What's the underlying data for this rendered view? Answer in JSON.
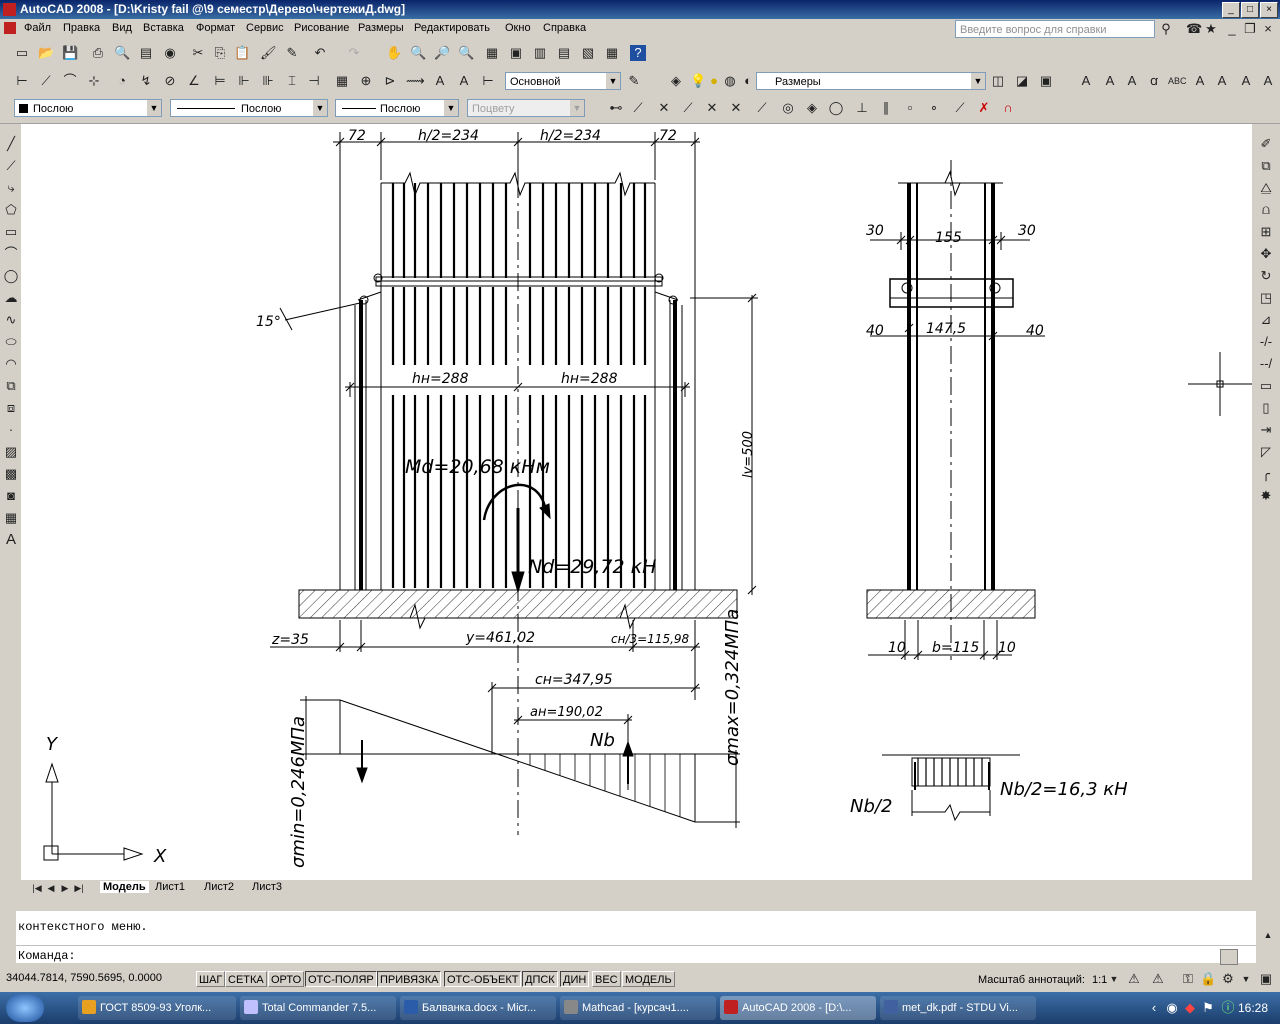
{
  "window": {
    "title": "AutoCAD 2008 - [D:\\Kristy fail @\\9 семестр\\Дерево\\чертежиД.dwg]",
    "controls": [
      "_",
      "□",
      "×"
    ]
  },
  "menu": {
    "items": [
      "Файл",
      "Правка",
      "Вид",
      "Вставка",
      "Формат",
      "Сервис",
      "Рисование",
      "Размеры",
      "Редактировать",
      "Окно",
      "Справка"
    ],
    "help_placeholder": "Введите вопрос для справки"
  },
  "toolbar": {
    "text_style": "Основной",
    "dim_style": "Размеры",
    "color": "Послою",
    "linetype": "Послою",
    "lineweight": "Послою",
    "plot_style": "Поцвету"
  },
  "drawing": {
    "dim_72_left": "72",
    "dim_h2_left": "h/2=234",
    "dim_h2_right": "h/2=234",
    "dim_72_right": "72",
    "angle": "15°",
    "dim_hn_left": "hн=288",
    "dim_hn_right": "hн=288",
    "moment": "Md=20,68  кНм",
    "force": "Nd=29,72  кН",
    "lv": "lv=500",
    "z": "z=35",
    "y": "y=461,02",
    "cn3": "cн/3=115,98",
    "cn": "cн=347,95",
    "an": "aн=190,02",
    "nb": "Nb",
    "smax": "σmax=0,324МПа",
    "smin": "σmin=0,246МПа",
    "side_30_left": "30",
    "side_155": "155",
    "side_30_right": "30",
    "side_40_left": "40",
    "side_147": "147,5",
    "side_40_right": "40",
    "side_10_left": "10",
    "side_b": "b=115",
    "side_10_right": "10",
    "nb2_left": "Nb/2",
    "nb2_right": "Nb/2=16,3  кН",
    "ucs_y": "Y",
    "ucs_x": "X"
  },
  "tabs": [
    "Модель",
    "Лист1",
    "Лист2",
    "Лист3"
  ],
  "command": {
    "history": "контекстного меню.",
    "prompt": "Команда:"
  },
  "status": {
    "coords": "34044.7814, 7590.5695, 0.0000",
    "buttons": [
      "ШАГ",
      "СЕТКА",
      "ОРТО",
      "ОТС-ПОЛЯР",
      "ПРИВЯЗКА",
      "ОТС-ОБЪЕКТ",
      "ДПСК",
      "ДИН",
      "ВЕС",
      "МОДЕЛЬ"
    ],
    "annotation_scale_label": "Масштаб аннотаций:",
    "annotation_scale": "1:1"
  },
  "taskbar": {
    "tasks": [
      {
        "label": "ГОСТ 8509-93 Уголк...",
        "color": "#e8a020"
      },
      {
        "label": "Total Commander 7.5...",
        "color": "#c0c0ff"
      },
      {
        "label": "Балванка.docx - Micr...",
        "color": "#2a5caa"
      },
      {
        "label": "Mathcad - [курсач1....",
        "color": "#888888"
      },
      {
        "label": "AutoCAD 2008 - [D:\\...",
        "color": "#c02020"
      },
      {
        "label": "met_dk.pdf - STDU Vi...",
        "color": "#4060a0"
      }
    ],
    "clock": "16:28"
  }
}
